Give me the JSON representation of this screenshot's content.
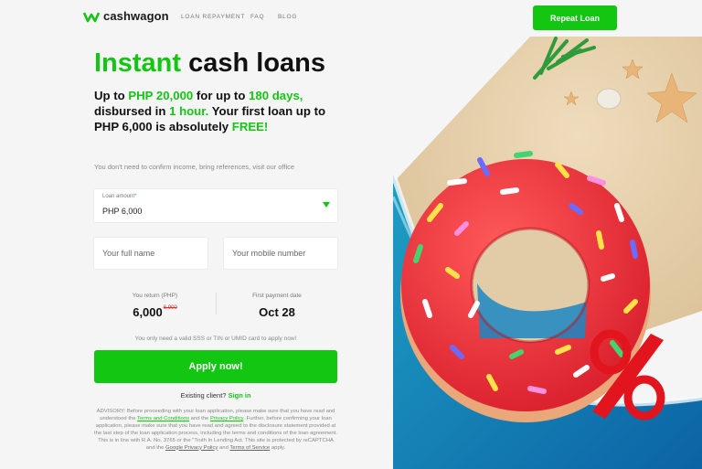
{
  "header": {
    "logo_text": "cashwagon",
    "nav": [
      "LOAN REPAYMENT",
      "FAQ",
      "BLOG"
    ],
    "repeat_loan_label": "Repeat Loan"
  },
  "hero": {
    "title_green": "Instant",
    "title_rest": " cash loans",
    "subtitle": {
      "p1": "Up to ",
      "amount": "PHP 20,000",
      "p2": " for up to ",
      "days": "180 days,",
      "p3": " disbursed in ",
      "hour": "1 hour.",
      "p4": " Your first loan up to PHP 6,000 is absolutely ",
      "free": "FREE!"
    },
    "note": "You don't need to confirm income, bring references, visit our office"
  },
  "form": {
    "loan_amount_label": "Loan amount",
    "loan_amount_value": "PHP 6,000",
    "name_placeholder": "Your full name",
    "mobile_placeholder": "Your mobile number",
    "return_label": "You return (PHP)",
    "return_value": "6,000",
    "return_old": "6,900",
    "first_payment_label": "First payment date",
    "first_payment_value": "Oct 28",
    "id_note": "You only need a valid SSS or TIN or UMID card to apply now!",
    "apply_label": "Apply now!",
    "existing_text": "Existing client?",
    "sign_in_label": "Sign in"
  },
  "advisory": {
    "t1": "ADVISORY: Before proceeding with your loan application, please make sure that you have read and understood the ",
    "terms": "Terms and Conditions",
    "t2": " and the ",
    "privacy": "Privacy Policy",
    "t3": ". Further, before confirming your loan application, please make sure that you have read and agreed to the disclosure statement provided at the last step of the loan application process, including the terms and conditions of the loan agreement. This is in line with R.A. No. 3765 or the \"Truth In Lending Act. This site is protected by reCAPTCHA and the ",
    "google_privacy": "Google Privacy Policy",
    "t4": " and ",
    "tos": "Terms of Service",
    "t5": " apply."
  },
  "colors": {
    "accent": "#12c612",
    "background": "#f5f5f5"
  },
  "icons": {
    "logo": "cashwagon-logo-icon",
    "dropdown": "chevron-down-icon"
  }
}
